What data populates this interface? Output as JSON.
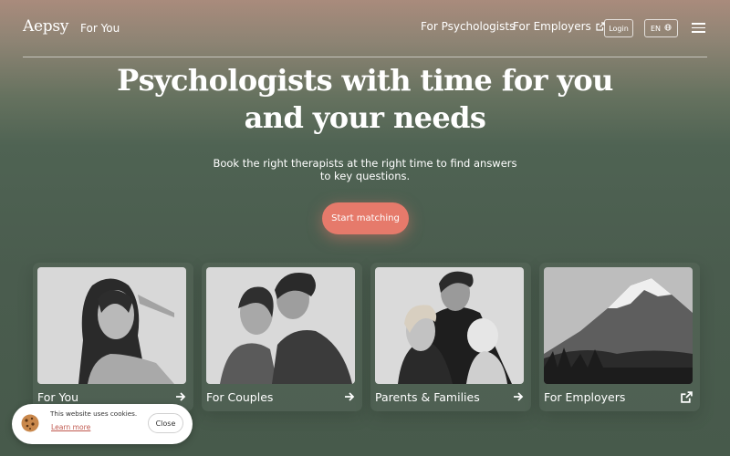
{
  "header": {
    "logo": "Aepsy",
    "nav_for_you": "For You",
    "nav_psychologists": "For Psychologists",
    "nav_employers": "For Employers",
    "login_label": "Login",
    "language_label": "EN"
  },
  "hero": {
    "title": "Psychologists with time for you and your needs",
    "subtitle": "Book the right therapists at the right time to find answers to key questions.",
    "cta_label": "Start matching"
  },
  "cards": [
    {
      "label": "For You",
      "icon": "arrow-right-icon",
      "image": "woman-portrait-photo"
    },
    {
      "label": "For Couples",
      "icon": "arrow-right-icon",
      "image": "couple-photo"
    },
    {
      "label": "Parents & Families",
      "icon": "arrow-right-icon",
      "image": "family-photo"
    },
    {
      "label": "For Employers",
      "icon": "external-link-icon",
      "image": "mountain-photo"
    }
  ],
  "cookie": {
    "text": "This website uses cookies.",
    "link": "Learn more",
    "close_label": "Close"
  },
  "colors": {
    "accent": "#e67a6b",
    "background": "#4a5c4e",
    "link": "#c0594f"
  }
}
